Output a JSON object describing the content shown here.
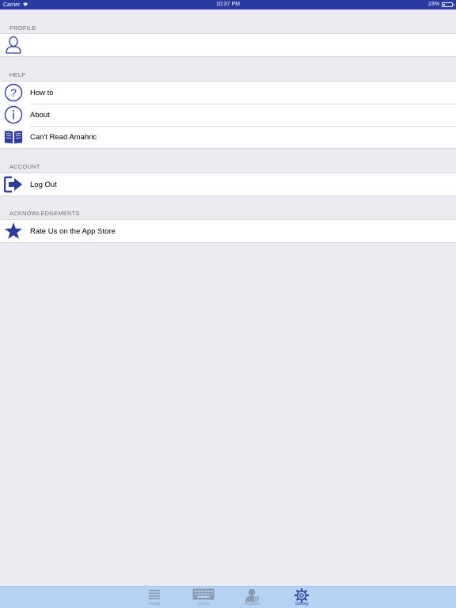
{
  "status_bar": {
    "carrier": "Carrier",
    "time": "10:37 PM",
    "battery": "23%",
    "battery_level": 0.23
  },
  "sections": {
    "profile": {
      "header": "PROFILE"
    },
    "help": {
      "header": "HELP",
      "items": [
        {
          "label": "How to",
          "icon": "question-circle-icon"
        },
        {
          "label": "About",
          "icon": "info-circle-icon"
        },
        {
          "label": "Can't Read Amahric",
          "icon": "open-book-icon"
        }
      ]
    },
    "account": {
      "header": "ACCOUNT",
      "items": [
        {
          "label": "Log Out",
          "icon": "logout-arrow-icon"
        }
      ]
    },
    "acknowledgements": {
      "header": "ACKNOWLEDGEMENTS",
      "items": [
        {
          "label": "Rate Us on the App Store",
          "icon": "star-icon"
        }
      ]
    }
  },
  "tab_bar": {
    "tabs": [
      {
        "label": "Feeds",
        "icon": "list-icon",
        "active": false
      },
      {
        "label": "Check",
        "icon": "keyboard-icon",
        "active": false
      },
      {
        "label": "Register",
        "icon": "user-add-icon",
        "active": false
      },
      {
        "label": "Setting",
        "icon": "gear-icon",
        "active": true
      }
    ]
  },
  "colors": {
    "accent": "#2b3ba1",
    "background": "#ebebf1",
    "tab_bar": "#b5d2f2",
    "inactive_tab": "#8a9bb0"
  }
}
